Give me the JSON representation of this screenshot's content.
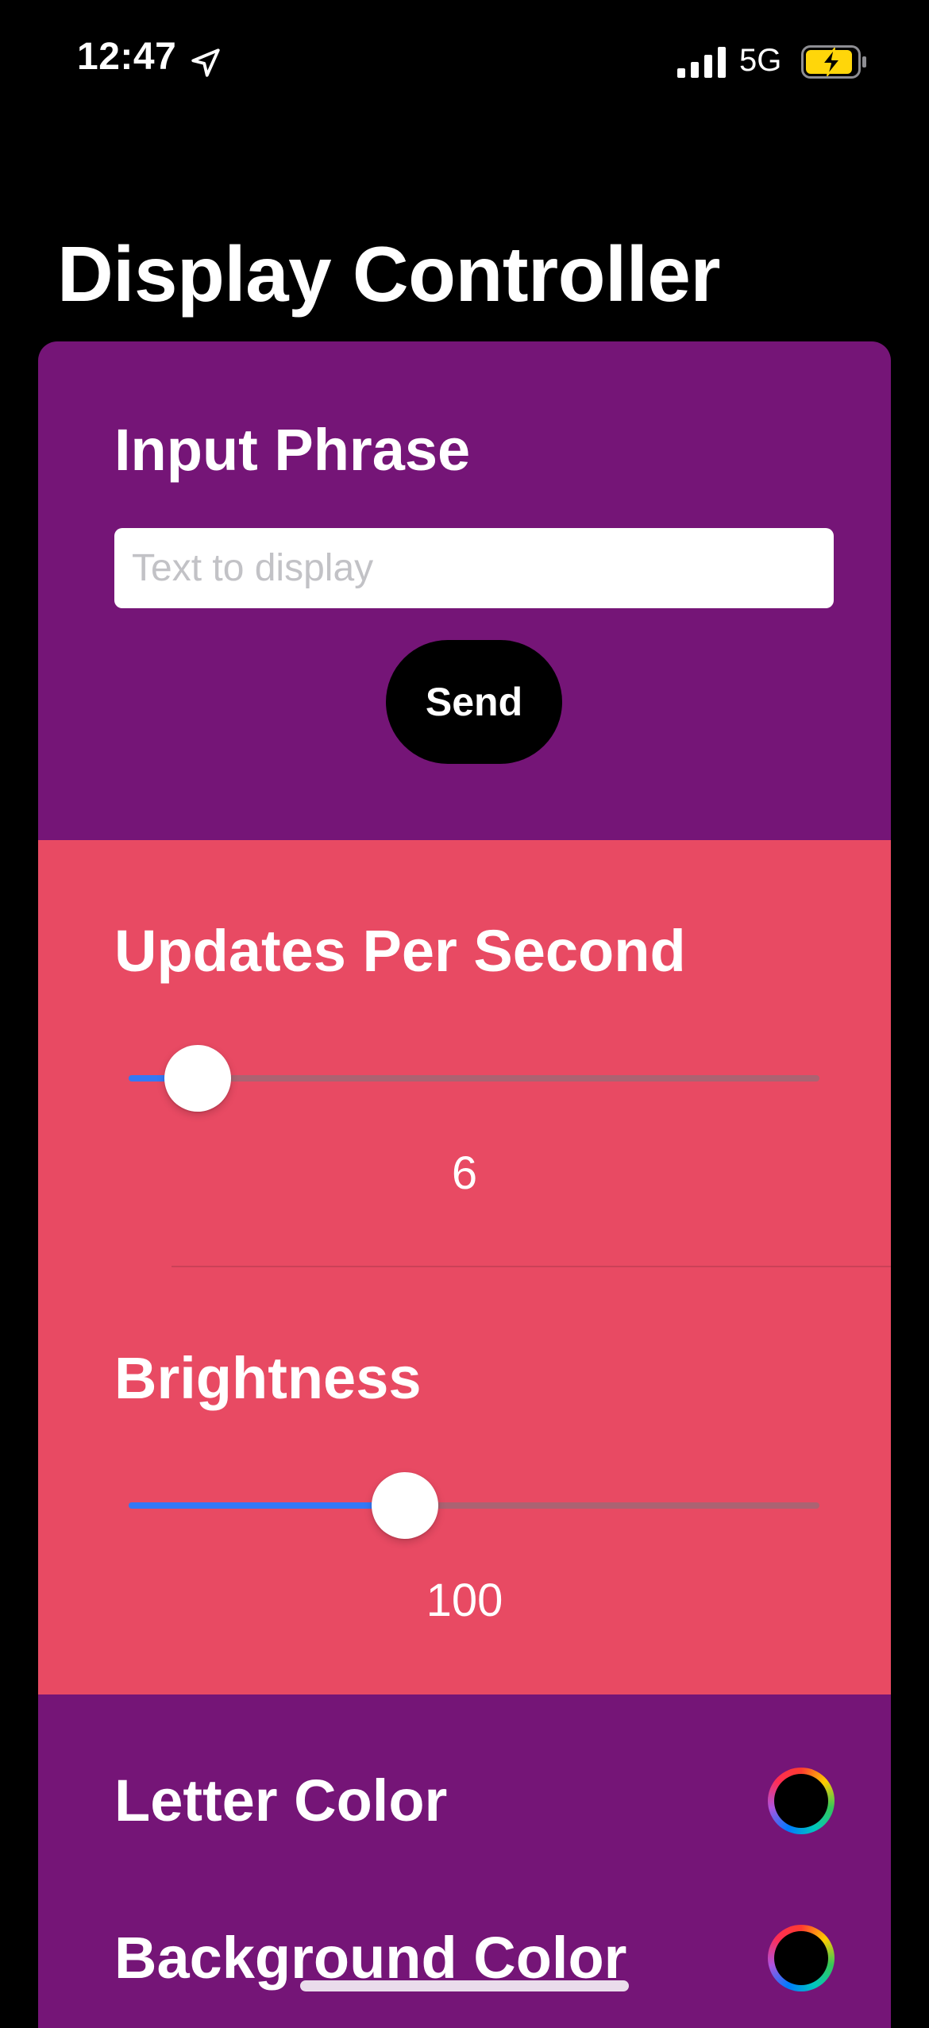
{
  "status_bar": {
    "time": "12:47",
    "network": "5G",
    "icons": [
      "location-arrow-icon",
      "cellular-signal-icon",
      "battery-charging-icon"
    ]
  },
  "page": {
    "title": "Display Controller"
  },
  "input_section": {
    "heading": "Input Phrase",
    "input_value": "",
    "input_placeholder": "Text to display",
    "send_label": "Send",
    "background": "#751577"
  },
  "sliders_section": {
    "background": "#e84a63",
    "accent": "#3478f6",
    "updates": {
      "heading": "Updates Per Second",
      "value": "6",
      "fraction": 0.1
    },
    "brightness": {
      "heading": "Brightness",
      "value": "100",
      "fraction": 0.4
    }
  },
  "colors_section": {
    "background": "#751577",
    "letter_color": {
      "label": "Letter Color",
      "value": "#000000"
    },
    "background_color": {
      "label": "Background Color",
      "value": "#000000"
    }
  }
}
